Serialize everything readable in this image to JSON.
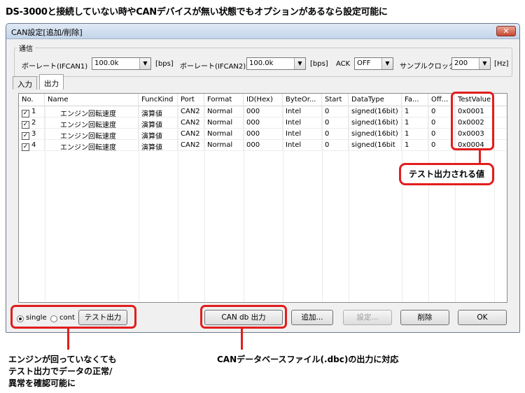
{
  "heading": "DS-3000と接続していない時やCANデバイスが無い状態でもオプションがあるなら設定可能に",
  "window": {
    "title": "CAN設定[追加/削除]",
    "close": "✕"
  },
  "comm": {
    "group_label": "通信",
    "baud1_label": "ボーレート(IFCAN1)",
    "baud1_value": "100.0k",
    "baud1_unit": "[bps]",
    "baud2_label": "ボーレート(IFCAN2)",
    "baud2_value": "100.0k",
    "baud2_unit": "[bps]",
    "ack_label": "ACK",
    "ack_value": "OFF",
    "clock_label": "サンプルクロック",
    "clock_value": "200",
    "clock_unit": "[Hz]"
  },
  "tabs": [
    "入力",
    "出力"
  ],
  "columns": [
    "No.",
    "Name",
    "FuncKind",
    "Port",
    "Format",
    "ID(Hex)",
    "ByteOr...",
    "Start",
    "DataType",
    "Fa...",
    "Off...",
    "TestValue"
  ],
  "rows": [
    [
      "1",
      "エンジン回転速度",
      "演算値",
      "CAN2",
      "Normal",
      "000",
      "Intel",
      "0",
      "signed(16bit)",
      "1",
      "0",
      "0x0001"
    ],
    [
      "2",
      "エンジン回転速度",
      "演算値",
      "CAN2",
      "Normal",
      "000",
      "Intel",
      "0",
      "signed(16bit)",
      "1",
      "0",
      "0x0002"
    ],
    [
      "3",
      "エンジン回転速度",
      "演算値",
      "CAN2",
      "Normal",
      "000",
      "Intel",
      "0",
      "signed(16bit)",
      "1",
      "0",
      "0x0003"
    ],
    [
      "4",
      "エンジン回転速度",
      "演算値",
      "CAN2",
      "Normal",
      "000",
      "Intel",
      "0",
      "signed(16bit",
      "1",
      "0",
      "0x0004"
    ]
  ],
  "bottom": {
    "single": "single",
    "cont": "cont",
    "test_output": "テスト出力",
    "candb_output": "CAN db 出力",
    "add": "追加...",
    "settings": "設定...",
    "delete": "削除",
    "ok": "OK"
  },
  "annotations": {
    "test_value_callout": "テスト出力される値",
    "left_note": [
      "エンジンが回っていなくても",
      "テスト出力でデータの正常/",
      "異常を確認可能に"
    ],
    "center_note": "CANデータベースファイル(.dbc)の出力に対応"
  },
  "colors": {
    "highlight": "#e21d1d"
  }
}
